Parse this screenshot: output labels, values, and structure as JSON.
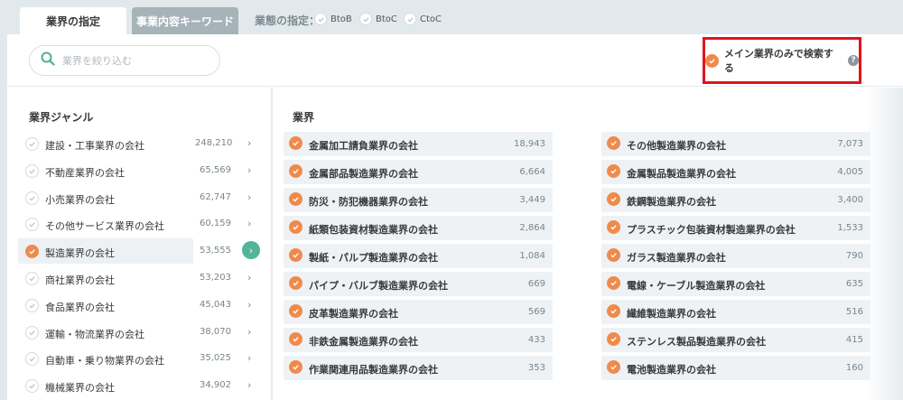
{
  "tabs": [
    {
      "label": "業界の指定",
      "active": true
    },
    {
      "label": "事業内容キーワード",
      "active": false
    }
  ],
  "business_type": {
    "label": "業態の指定：",
    "options": [
      "BtoB",
      "BtoC",
      "CtoC"
    ]
  },
  "search": {
    "placeholder": "業界を絞り込む",
    "value": ""
  },
  "main_only": {
    "label": "メイン業界のみで検索する",
    "checked": true,
    "help_icon": "?"
  },
  "sidebar": {
    "title": "業界ジャンル",
    "items": [
      {
        "label": "建設・工事業界の会社",
        "count": "248,210",
        "selected": false
      },
      {
        "label": "不動産業界の会社",
        "count": "65,569",
        "selected": false
      },
      {
        "label": "小売業界の会社",
        "count": "62,747",
        "selected": false
      },
      {
        "label": "その他サービス業界の会社",
        "count": "60,159",
        "selected": false
      },
      {
        "label": "製造業界の会社",
        "count": "53,555",
        "selected": true
      },
      {
        "label": "商社業界の会社",
        "count": "53,203",
        "selected": false
      },
      {
        "label": "食品業界の会社",
        "count": "45,043",
        "selected": false
      },
      {
        "label": "運輸・物流業界の会社",
        "count": "38,070",
        "selected": false
      },
      {
        "label": "自動車・乗り物業界の会社",
        "count": "35,025",
        "selected": false
      },
      {
        "label": "機械業界の会社",
        "count": "34,902",
        "selected": false
      }
    ]
  },
  "industries": {
    "title": "業界",
    "left": [
      {
        "label": "金属加工請負業界の会社",
        "count": "18,943"
      },
      {
        "label": "金属部品製造業界の会社",
        "count": "6,664"
      },
      {
        "label": "防災・防犯機器業界の会社",
        "count": "3,449"
      },
      {
        "label": "紙類包装資材製造業界の会社",
        "count": "2,864"
      },
      {
        "label": "製紙・パルプ製造業界の会社",
        "count": "1,084"
      },
      {
        "label": "パイプ・バルブ製造業界の会社",
        "count": "669"
      },
      {
        "label": "皮革製造業界の会社",
        "count": "569"
      },
      {
        "label": "非鉄金属製造業界の会社",
        "count": "433"
      },
      {
        "label": "作業関連用品製造業界の会社",
        "count": "353"
      }
    ],
    "right": [
      {
        "label": "その他製造業界の会社",
        "count": "7,073"
      },
      {
        "label": "金属製品製造業界の会社",
        "count": "4,005"
      },
      {
        "label": "鉄鋼製造業界の会社",
        "count": "3,400"
      },
      {
        "label": "プラスチック包装資材製造業界の会社",
        "count": "1,533"
      },
      {
        "label": "ガラス製造業界の会社",
        "count": "790"
      },
      {
        "label": "電線・ケーブル製造業界の会社",
        "count": "635"
      },
      {
        "label": "繊維製造業界の会社",
        "count": "516"
      },
      {
        "label": "ステンレス製品製造業界の会社",
        "count": "415"
      },
      {
        "label": "電池製造業界の会社",
        "count": "160"
      }
    ]
  },
  "colors": {
    "accent": "#f08a4b",
    "selected_arrow": "#54b49a",
    "highlight_border": "#e0141a"
  }
}
